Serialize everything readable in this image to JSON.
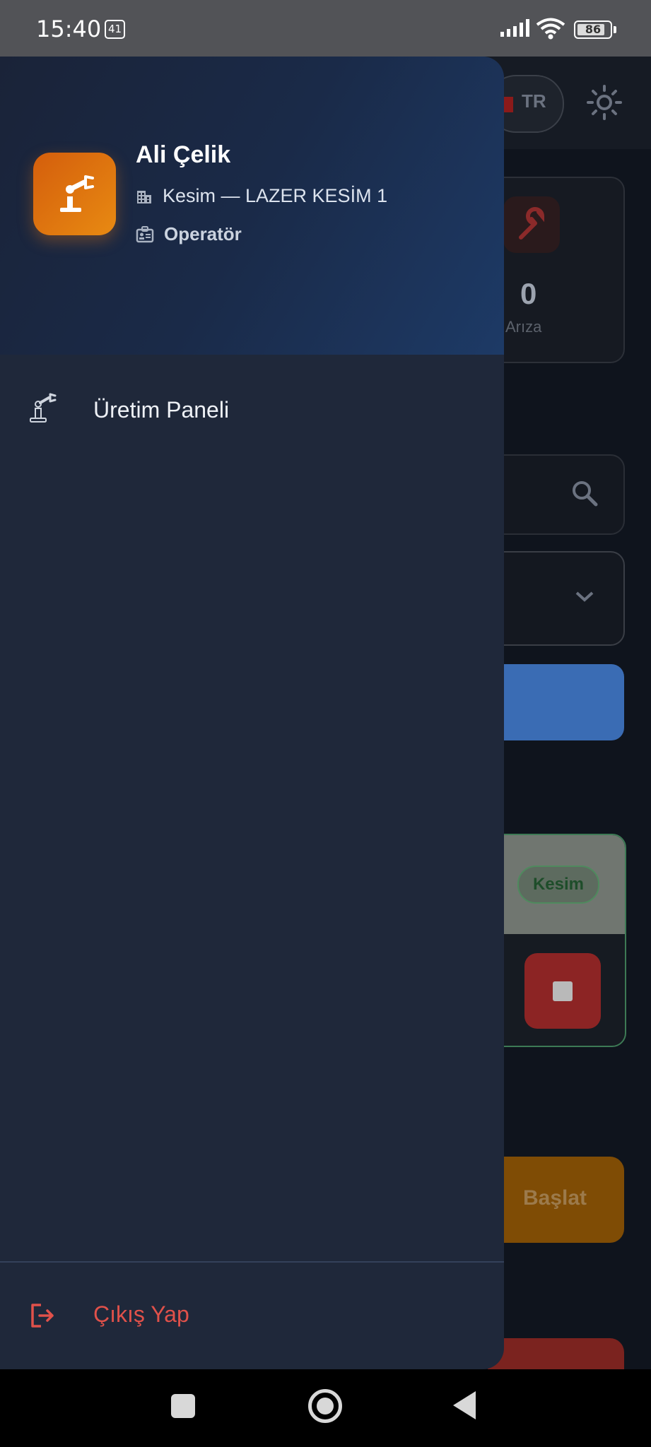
{
  "status_bar": {
    "time": "15:40",
    "notification_count": "41",
    "battery": "86"
  },
  "background": {
    "language": "TR",
    "stat": {
      "value": "0",
      "label": "ktif Arıza"
    },
    "card_badge": "Kesim",
    "start_label": "Başlat"
  },
  "drawer": {
    "user": {
      "name": "Ali Çelik",
      "department": "Kesim — LAZER KESİM 1",
      "role": "Operatör"
    },
    "menu": [
      {
        "label": "Üretim Paneli",
        "icon": "robot-arm-icon"
      }
    ],
    "logout_label": "Çıkış Yap"
  },
  "colors": {
    "accent_orange": "#e88a12",
    "drawer_bg": "#1f283a",
    "logout_red": "#e0514a"
  }
}
